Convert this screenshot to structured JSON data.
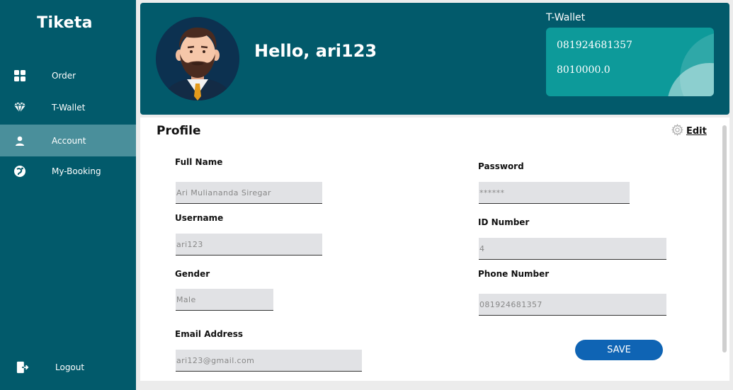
{
  "sidebar": {
    "brand": "Tiketa",
    "items": [
      {
        "label": "Order",
        "icon": "grid-icon"
      },
      {
        "label": "T-Wallet",
        "icon": "diamond-icon"
      },
      {
        "label": "Account",
        "icon": "person-icon"
      },
      {
        "label": "My-Booking",
        "icon": "booking-icon"
      }
    ],
    "active_item": "Account",
    "logout_label": "Logout"
  },
  "header": {
    "greeting": "Hello, ari123",
    "wallet": {
      "title": "T-Wallet",
      "phone": "081924681357",
      "balance": "8010000.0"
    }
  },
  "profile": {
    "title": "Profile",
    "edit_label": "Edit",
    "fields": {
      "full_name": {
        "label": "Full Name",
        "value": "Ari Muliananda Siregar"
      },
      "username": {
        "label": "Username",
        "value": "ari123"
      },
      "gender": {
        "label": "Gender",
        "value": "Male"
      },
      "email": {
        "label": "Email Address",
        "value": "ari123@gmail.com"
      },
      "password": {
        "label": "Password",
        "value": "******"
      },
      "id_number": {
        "label": "ID Number",
        "value": "4"
      },
      "phone": {
        "label": "Phone Number",
        "value": "081924681357"
      }
    },
    "save_label": "SAVE"
  },
  "colors": {
    "sidebar": "#025a6b",
    "active": "#4a8f9b",
    "wallet_card": "#0d9a9a",
    "save_button": "#0f64b4"
  }
}
